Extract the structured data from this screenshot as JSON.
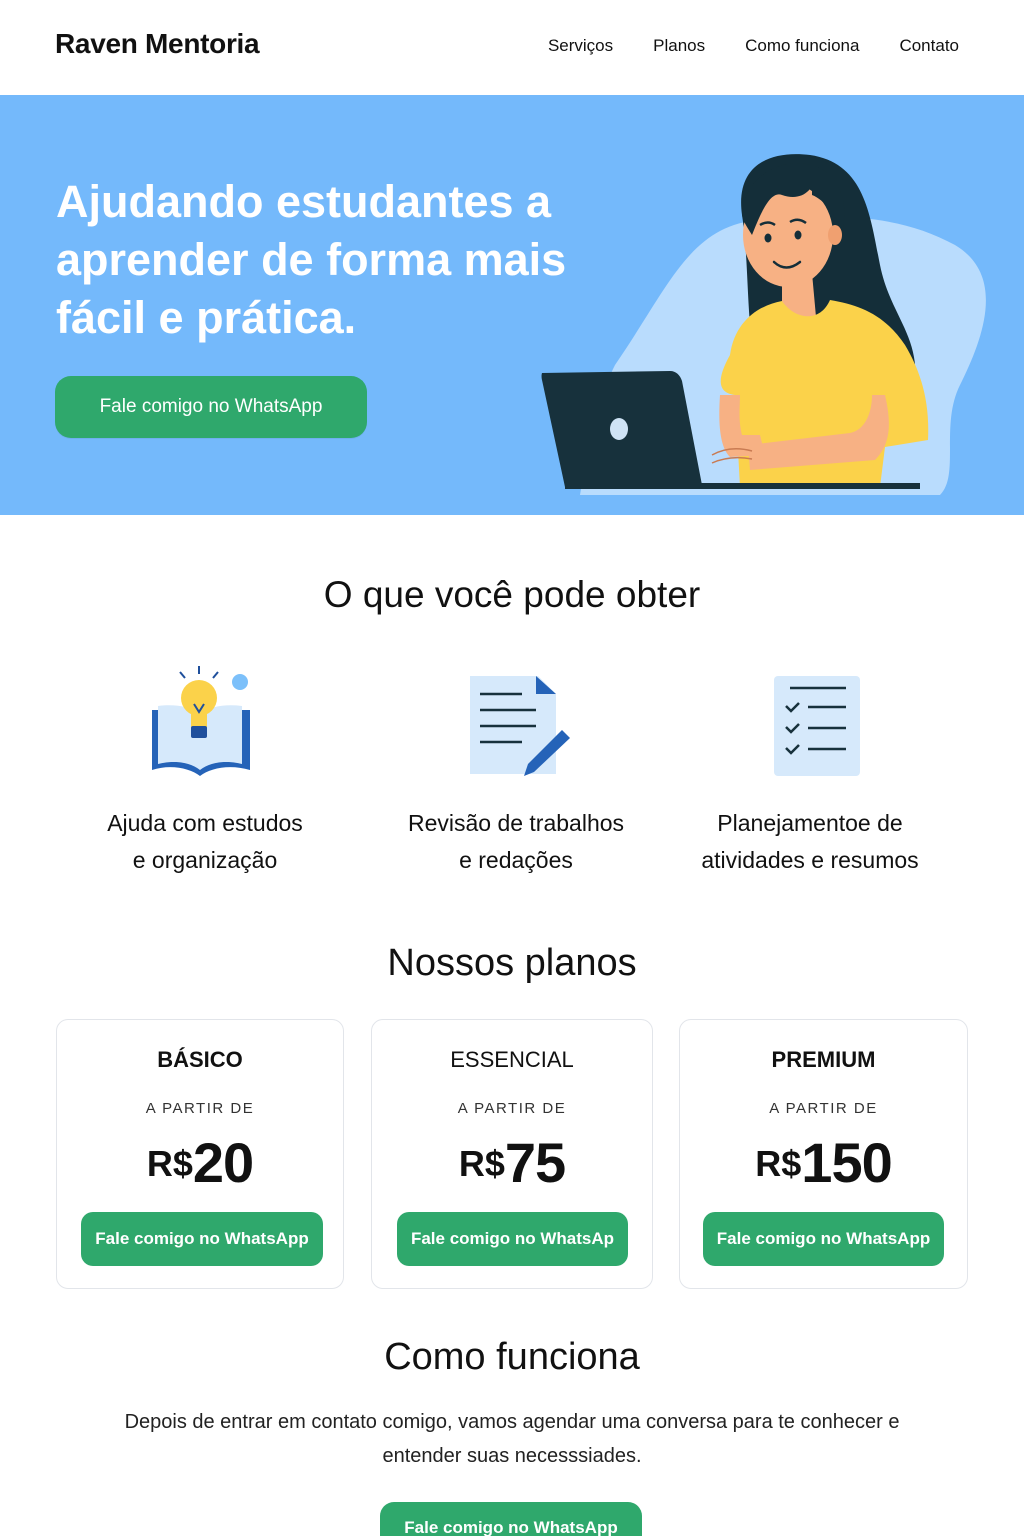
{
  "header": {
    "brand": "Raven Mentoria",
    "nav": [
      "Serviços",
      "Planos",
      "Como funciona",
      "Contato"
    ]
  },
  "hero": {
    "title": "Ajudando estudantes a aprender de forma mais fácil e prática.",
    "cta_label": "Fale comigo no WhatsApp"
  },
  "features": {
    "title": "O que você pode obter",
    "items": [
      {
        "icon": "book-lightbulb-icon",
        "line1": "Ajuda com estudos",
        "line2": "e organização"
      },
      {
        "icon": "document-pencil-icon",
        "line1": "Revisão de trabalhos",
        "line2": "e redações"
      },
      {
        "icon": "checklist-icon",
        "line1": "Planejamentoe de",
        "line2": "atividades e resumos"
      }
    ]
  },
  "plans": {
    "title": "Nossos planos",
    "items": [
      {
        "name": "BÁSICO",
        "from": "A PARTIR DE",
        "currency": "R$",
        "amount": "20",
        "cta": "Fale comigo no WhatsApp"
      },
      {
        "name": "ESSENCIAL",
        "from": "A PARTIR DE",
        "currency": "R$",
        "amount": "75",
        "cta": "Fale comigo no WhatsAp"
      },
      {
        "name": "PREMIUM",
        "from": "A PARTIR DE",
        "currency": "R$",
        "amount": "150",
        "cta": "Fale comigo no WhatsApp"
      }
    ]
  },
  "how": {
    "title": "Como funciona",
    "text": "Depois de entrar em contato comigo, vamos agendar uma conversa para te conhecer e entender suas necesssiades.",
    "cta_label": "Fale comigo no WhatsApp"
  },
  "colors": {
    "hero_bg": "#74b9fb",
    "accent_green": "#2fa86c",
    "shirt_yellow": "#fbd24a",
    "laptop_dark": "#17313c",
    "icon_blue": "#2563b8"
  }
}
